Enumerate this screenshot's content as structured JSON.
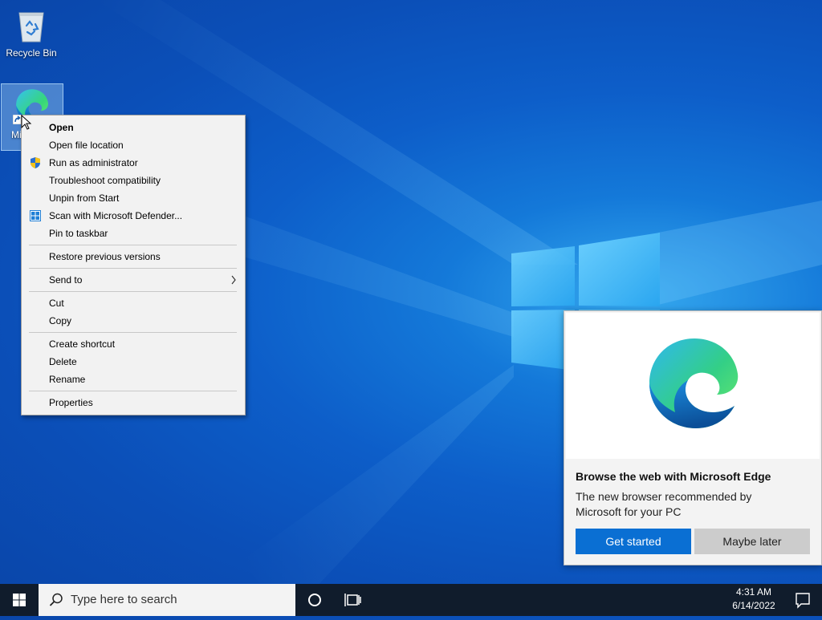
{
  "desktop": {
    "icons": [
      {
        "label": "Recycle Bin",
        "icon": "recycle-bin-icon"
      },
      {
        "label": "Microsoft Edge",
        "label_visible": "Mi",
        "icon": "edge-icon",
        "selected": true
      }
    ]
  },
  "context_menu": {
    "items": [
      {
        "label": "Open",
        "bold": true
      },
      {
        "label": "Open file location"
      },
      {
        "label": "Run as administrator",
        "icon": "uac-shield-icon"
      },
      {
        "label": "Troubleshoot compatibility"
      },
      {
        "label": "Unpin from Start"
      },
      {
        "label": "Scan with Microsoft Defender...",
        "icon": "defender-icon"
      },
      {
        "label": "Pin to taskbar"
      },
      {
        "label": "Restore previous versions"
      },
      {
        "label": "Send to",
        "submenu": true
      },
      {
        "label": "Cut"
      },
      {
        "label": "Copy"
      },
      {
        "label": "Create shortcut"
      },
      {
        "label": "Delete"
      },
      {
        "label": "Rename"
      },
      {
        "label": "Properties"
      }
    ]
  },
  "edge_popup": {
    "title": "Browse the web with Microsoft Edge",
    "body": "The new browser recommended by Microsoft for your PC",
    "primary_button": "Get started",
    "secondary_button": "Maybe later"
  },
  "taskbar": {
    "search_placeholder": "Type here to search",
    "time": "4:31 AM",
    "date": "6/14/2022"
  },
  "colors": {
    "accent": "#0a6fd3",
    "taskbar": "#101c2c",
    "menu_bg": "#f2f2f2"
  }
}
